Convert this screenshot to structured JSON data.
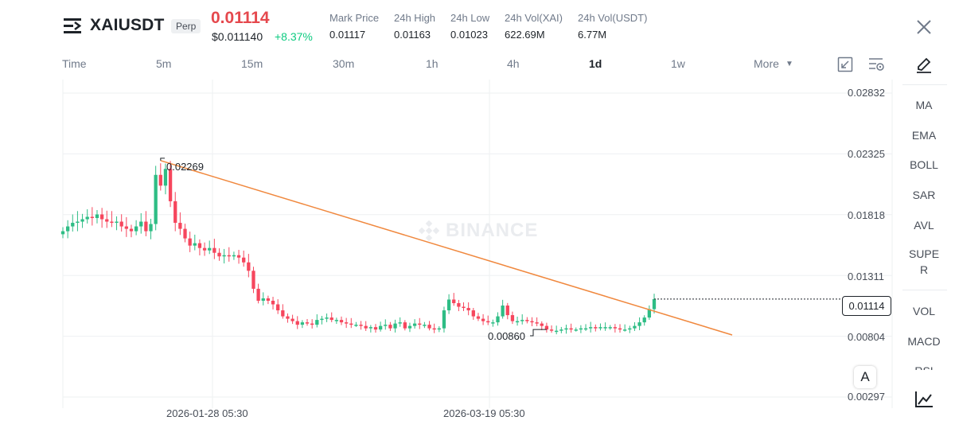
{
  "header": {
    "symbol": "XAIUSDT",
    "contract_type": "Perp",
    "last_price": "0.01114",
    "usd_price": "$0.011140",
    "change": "+8.37%",
    "stats": [
      {
        "label": "Mark Price",
        "value": "0.01117"
      },
      {
        "label": "24h High",
        "value": "0.01163"
      },
      {
        "label": "24h Low",
        "value": "0.01023"
      },
      {
        "label": "24h Vol(XAI)",
        "value": "622.69M"
      },
      {
        "label": "24h Vol(USDT)",
        "value": "6.77M"
      }
    ]
  },
  "timeframes": {
    "items": [
      "Time",
      "5m",
      "15m",
      "30m",
      "1h",
      "4h",
      "1d",
      "1w"
    ],
    "active": "1d",
    "more_label": "More"
  },
  "indicators": [
    "MA",
    "EMA",
    "BOLL",
    "SAR",
    "AVL",
    "SUPE\nR",
    "VOL",
    "MACD",
    "RSI"
  ],
  "indicator_labels": {
    "ma": "MA",
    "ema": "EMA",
    "boll": "BOLL",
    "sar": "SAR",
    "avl": "AVL",
    "super_line1": "SUPE",
    "super_line2": "R",
    "vol": "VOL",
    "macd": "MACD",
    "rsi": "RSI"
  },
  "chart": {
    "watermark": "BINANCE",
    "price_axis": [
      "0.02832",
      "0.02325",
      "0.01818",
      "0.01311",
      "0.00804",
      "0.00297"
    ],
    "date_axis": [
      "2026-01-28 05:30",
      "2026-03-19 05:30"
    ],
    "current_price_tag": "0.01114",
    "high_annotation": "0.02269",
    "low_annotation": "0.00860",
    "scale_button": "A",
    "colors": {
      "up": "#2ebd85",
      "down": "#f6465d",
      "trendline": "#f0883e",
      "accent": "#e5484d"
    }
  },
  "chart_data": {
    "type": "candlestick",
    "interval": "1d",
    "ylim": [
      0.00297,
      0.02832
    ],
    "yticks": [
      0.02832,
      0.02325,
      0.01818,
      0.01311,
      0.00804,
      0.00297
    ],
    "x_labels": [
      "2026-01-28 05:30",
      "2026-03-19 05:30"
    ],
    "last": 0.01114,
    "high_marker": 0.02269,
    "low_marker": 0.0086,
    "candles_close": [
      0.0168,
      0.0172,
      0.0175,
      0.0176,
      0.0178,
      0.018,
      0.0179,
      0.0182,
      0.0178,
      0.0176,
      0.0175,
      0.0176,
      0.0172,
      0.017,
      0.0168,
      0.0172,
      0.0176,
      0.0168,
      0.0174,
      0.0215,
      0.0206,
      0.022,
      0.0193,
      0.0175,
      0.017,
      0.0162,
      0.0156,
      0.0158,
      0.0154,
      0.0152,
      0.0154,
      0.015,
      0.0147,
      0.0148,
      0.0147,
      0.0148,
      0.0146,
      0.0142,
      0.0135,
      0.012,
      0.011,
      0.0112,
      0.011,
      0.0107,
      0.0102,
      0.0097,
      0.0095,
      0.0093,
      0.009,
      0.0092,
      0.0091,
      0.009,
      0.0094,
      0.0095,
      0.0096,
      0.0094,
      0.0094,
      0.0092,
      0.0091,
      0.009,
      0.009,
      0.0089,
      0.0087,
      0.0088,
      0.0086,
      0.0089,
      0.009,
      0.0087,
      0.0091,
      0.0092,
      0.0087,
      0.0089,
      0.0091,
      0.009,
      0.009,
      0.0087,
      0.0086,
      0.0087,
      0.0102,
      0.0111,
      0.0108,
      0.0105,
      0.0104,
      0.0102,
      0.0097,
      0.0095,
      0.0093,
      0.0092,
      0.0092,
      0.0097,
      0.0106,
      0.0098,
      0.0093,
      0.0093,
      0.0094,
      0.0093,
      0.0092,
      0.0091,
      0.0089,
      0.0086,
      0.0085,
      0.0085,
      0.0086,
      0.0087,
      0.0086,
      0.0086,
      0.0087,
      0.0087,
      0.0088,
      0.0087,
      0.0088,
      0.0088,
      0.0088,
      0.0087,
      0.0086,
      0.0086,
      0.0087,
      0.0089,
      0.0092,
      0.0096,
      0.0103,
      0.01114
    ]
  }
}
